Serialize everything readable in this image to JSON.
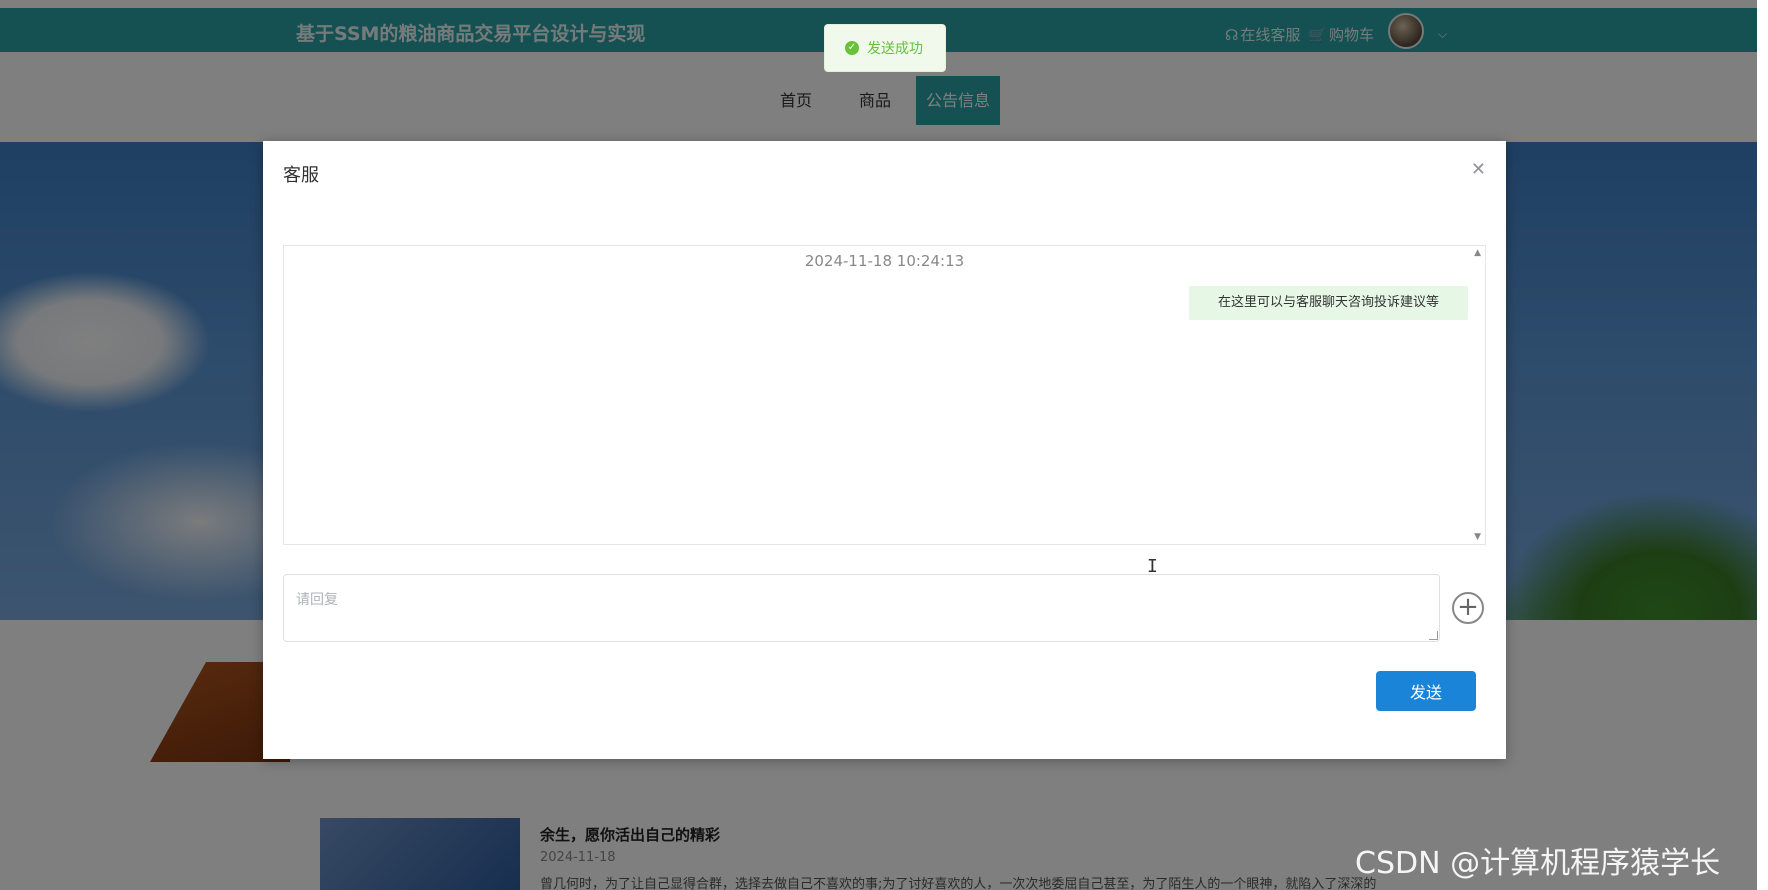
{
  "header": {
    "site_title": "基于SSM的粮油商品交易平台设计与实现",
    "online_service": "在线客服",
    "cart": "购物车"
  },
  "nav": {
    "items": [
      {
        "label": "首页"
      },
      {
        "label": "商品"
      },
      {
        "label": "公告信息"
      }
    ]
  },
  "toast": {
    "message": "发送成功"
  },
  "dialog": {
    "title": "客服",
    "chat_time": "2024-11-18 10:24:13",
    "message": "在这里可以与客服聊天咨询投诉建议等",
    "reply_placeholder": "请回复",
    "send_label": "发送"
  },
  "news": {
    "title": "余生，愿你活出自己的精彩",
    "date": "2024-11-18",
    "excerpt": "曾几何时，为了让自己显得合群，选择去做自己不喜欢的事;为了讨好喜欢的人，一次次地委屈自己甚至，为了陌生人的一个眼神，就陷入了深深的"
  },
  "watermark": "CSDN @计算机程序猿学长",
  "colors": {
    "primary": "#2aa3a6",
    "send_button": "#1a84d8",
    "toast_green": "#67c23a"
  }
}
